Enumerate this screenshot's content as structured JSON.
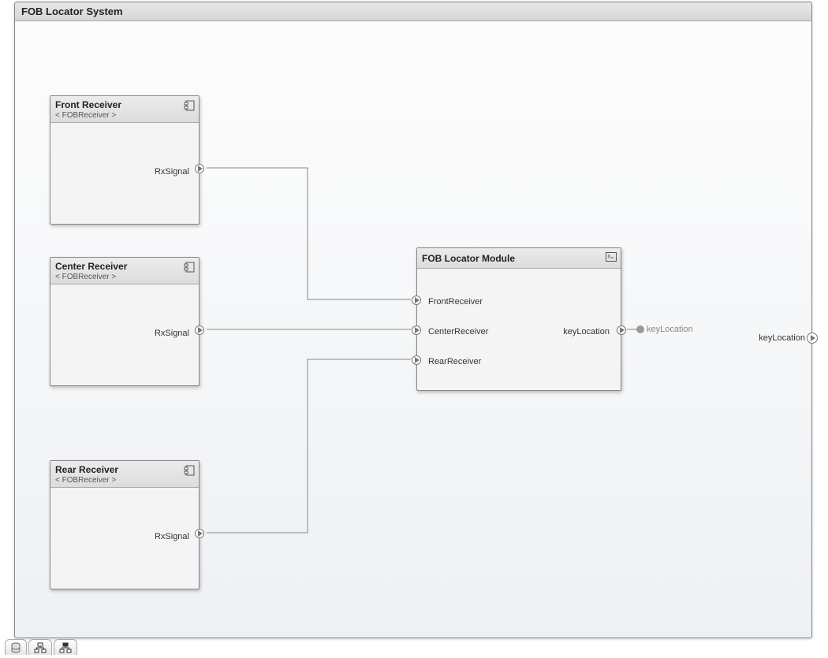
{
  "system": {
    "title": "FOB Locator System"
  },
  "blocks": {
    "front_receiver": {
      "title": "Front Receiver",
      "subtitle": "< FOBReceiver >",
      "out_port": "RxSignal"
    },
    "center_receiver": {
      "title": "Center Receiver",
      "subtitle": "< FOBReceiver >",
      "out_port": "RxSignal"
    },
    "rear_receiver": {
      "title": "Rear Receiver",
      "subtitle": "< FOBReceiver >",
      "out_port": "RxSignal"
    },
    "locator_module": {
      "title": "FOB Locator Module",
      "in_ports": [
        "FrontReceiver",
        "CenterReceiver",
        "RearReceiver"
      ],
      "out_port": "keyLocation"
    }
  },
  "signals": {
    "module_out_sink_label": "keyLocation",
    "system_out_label": "keyLocation"
  },
  "icons": {
    "component": "component-icon",
    "terminal": "terminal-icon",
    "db_tab": "database-icon",
    "tree_tab": "tree-icon",
    "hier_tab": "hierarchy-icon"
  },
  "colors": {
    "border": "#888888",
    "header_bg": "#dcdcdc",
    "block_bg": "#f4f4f4"
  }
}
